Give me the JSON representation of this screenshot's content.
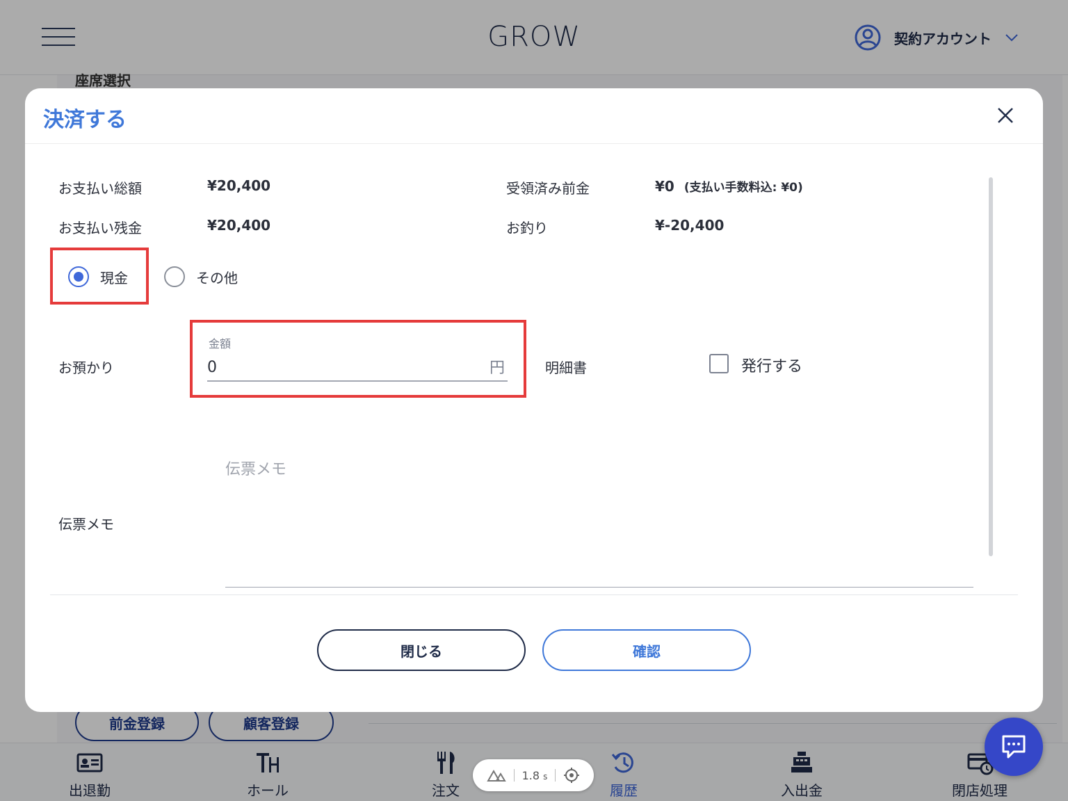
{
  "header": {
    "app_title": "GROW",
    "account_label": "契約アカウント"
  },
  "background": {
    "section_heading": "座席選択",
    "advance_button": "前金登録",
    "customer_button": "顧客登録"
  },
  "bottom_nav": {
    "items": [
      {
        "label": "出退勤",
        "icon": "id-card-icon"
      },
      {
        "label": "ホール",
        "icon": "table-layout-icon"
      },
      {
        "label": "注文",
        "icon": "fork-knife-icon"
      },
      {
        "label": "履歴",
        "icon": "history-icon"
      },
      {
        "label": "入出金",
        "icon": "cash-register-icon"
      },
      {
        "label": "閉店処理",
        "icon": "store-close-icon"
      }
    ],
    "active_index": 3
  },
  "perf": {
    "value": "1.8",
    "unit": "s"
  },
  "modal": {
    "title": "決済する",
    "total_label": "お支払い総額",
    "total_value": "¥20,400",
    "received_deposit_label": "受領済み前金",
    "received_deposit_value": "¥0",
    "received_deposit_note": "(支払い手数料込: ¥0)",
    "remaining_label": "お支払い残金",
    "remaining_value": "¥20,400",
    "change_label": "お釣り",
    "change_value": "¥-20,400",
    "payment_methods": [
      "現金",
      "その他"
    ],
    "selected_method": "現金",
    "deposit_label": "お預かり",
    "amount_caption": "金額",
    "amount_value": "0",
    "amount_unit": "円",
    "receipt_label": "明細書",
    "issue_label": "発行する",
    "memo_label": "伝票メモ",
    "memo_placeholder": "伝票メモ",
    "close_button": "閉じる",
    "confirm_button": "確認"
  },
  "colors": {
    "accent": "#3f78d9",
    "highlight": "#e53b3b",
    "dark": "#1f2b48",
    "fab": "#3547c8"
  }
}
